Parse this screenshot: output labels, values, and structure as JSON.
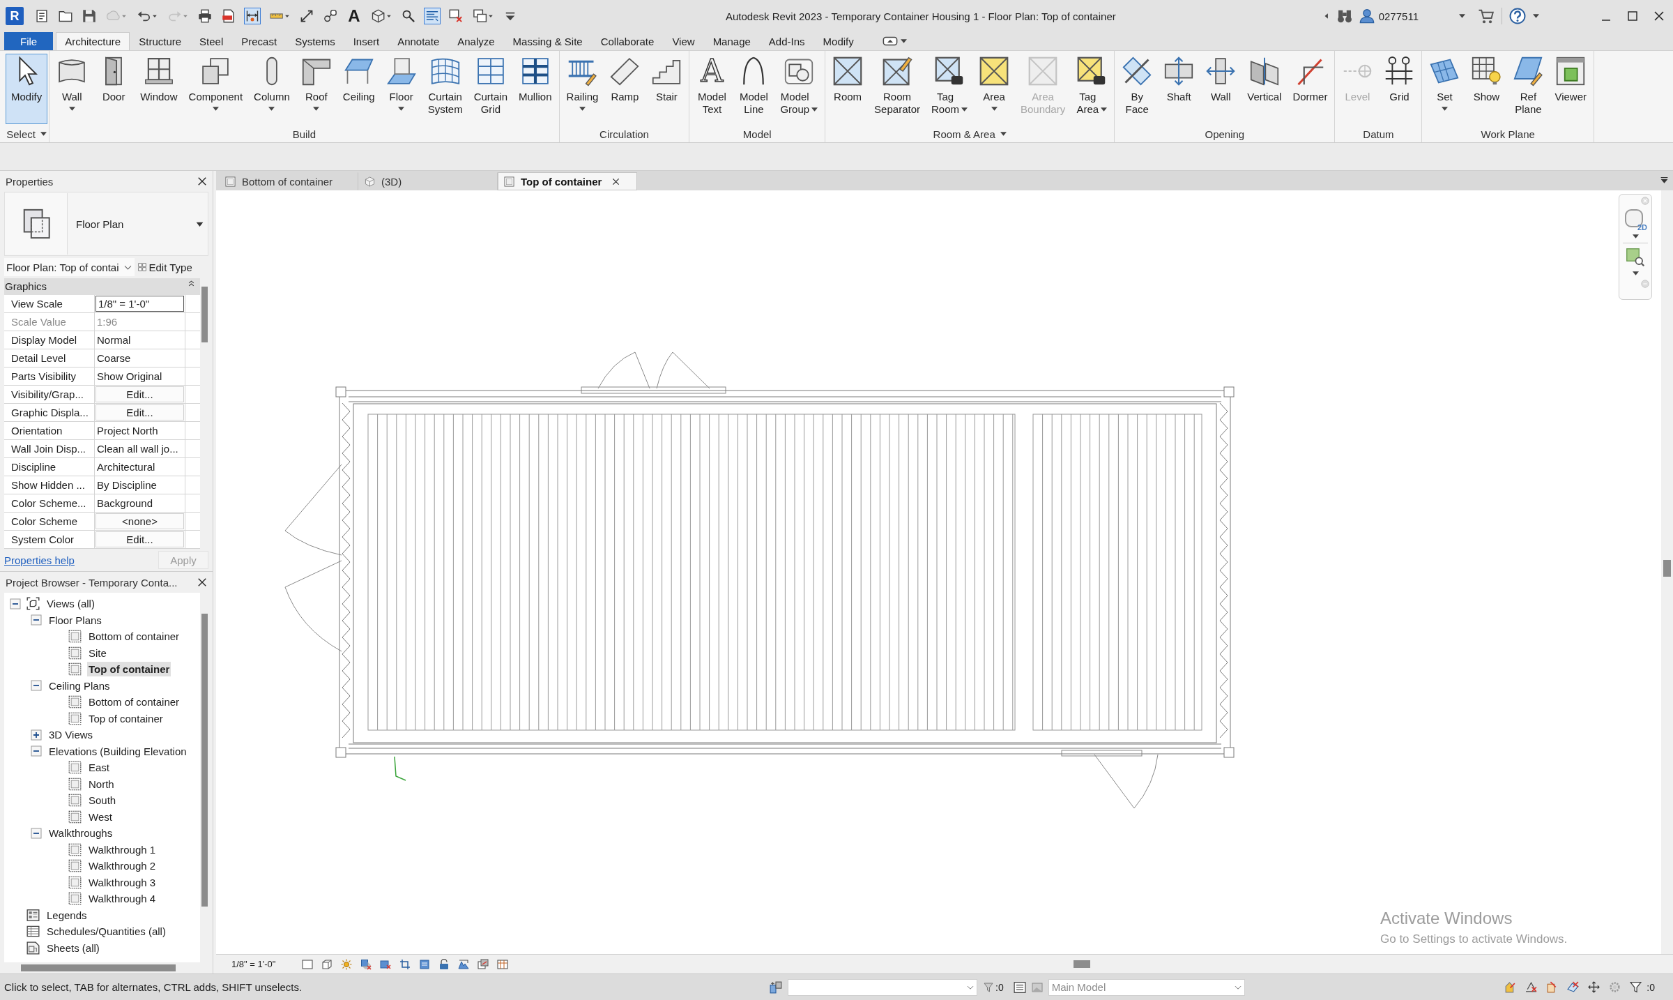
{
  "title_bar": {
    "logo": "R",
    "quick_access": [
      {
        "on": false,
        "dropdown": false,
        "disabled": false
      },
      {
        "on": false,
        "dropdown": false,
        "disabled": false
      },
      {
        "on": false,
        "dropdown": false,
        "disabled": false
      },
      {
        "on": false,
        "dropdown": true,
        "disabled": true
      },
      {
        "on": false,
        "dropdown": true,
        "disabled": false
      },
      {
        "on": false,
        "dropdown": true,
        "disabled": true
      },
      {
        "on": false,
        "dropdown": false,
        "disabled": false
      },
      {
        "on": false,
        "dropdown": false,
        "disabled": false
      },
      {
        "on": true,
        "dropdown": false,
        "disabled": false
      },
      {
        "on": false,
        "dropdown": true,
        "disabled": false
      },
      {
        "on": false,
        "dropdown": false,
        "disabled": false
      },
      {
        "on": false,
        "dropdown": false,
        "disabled": false
      },
      {
        "on": false,
        "dropdown": false,
        "disabled": false,
        "glyph": "A"
      },
      {
        "on": false,
        "dropdown": true,
        "disabled": false
      },
      {
        "on": false,
        "dropdown": false,
        "disabled": false
      },
      {
        "on": true,
        "dropdown": false,
        "disabled": false
      },
      {
        "on": false,
        "dropdown": false,
        "disabled": false
      },
      {
        "on": false,
        "dropdown": true,
        "disabled": false
      },
      {
        "on": false,
        "dropdown": false,
        "disabled": false
      }
    ],
    "title": "Autodesk Revit 2023 - Temporary Container Housing 1 - Floor Plan: Top of container",
    "user": "0277511"
  },
  "ribbon": {
    "file": "File",
    "tabs": [
      {
        "label": "Architecture",
        "selected": true
      },
      {
        "label": "Structure",
        "selected": false
      },
      {
        "label": "Steel",
        "selected": false
      },
      {
        "label": "Precast",
        "selected": false
      },
      {
        "label": "Systems",
        "selected": false
      },
      {
        "label": "Insert",
        "selected": false
      },
      {
        "label": "Annotate",
        "selected": false
      },
      {
        "label": "Analyze",
        "selected": false
      },
      {
        "label": "Massing & Site",
        "selected": false
      },
      {
        "label": "Collaborate",
        "selected": false
      },
      {
        "label": "View",
        "selected": false
      },
      {
        "label": "Manage",
        "selected": false
      },
      {
        "label": "Add-Ins",
        "selected": false
      },
      {
        "label": "Modify",
        "selected": false
      }
    ],
    "panels": [
      {
        "label": "Select",
        "dropdown": true,
        "tools": [
          {
            "label": "Modify",
            "dropdown": false,
            "disabled": false,
            "selected": true
          }
        ]
      },
      {
        "label": "Build",
        "dropdown": false,
        "tools": [
          {
            "label": "Wall",
            "dropdown": true,
            "disabled": false,
            "selected": false
          },
          {
            "label": "Door",
            "dropdown": false,
            "disabled": false,
            "selected": false
          },
          {
            "label": "Window",
            "dropdown": false,
            "disabled": false,
            "selected": false
          },
          {
            "label": "Component",
            "dropdown": true,
            "disabled": false,
            "selected": false
          },
          {
            "label": "Column",
            "dropdown": true,
            "disabled": false,
            "selected": false
          },
          {
            "label": "Roof",
            "dropdown": true,
            "disabled": false,
            "selected": false
          },
          {
            "label": "Ceiling",
            "dropdown": false,
            "disabled": false,
            "selected": false
          },
          {
            "label": "Floor",
            "dropdown": true,
            "disabled": false,
            "selected": false
          },
          {
            "label": "Curtain System",
            "dropdown": false,
            "disabled": false,
            "selected": false
          },
          {
            "label": "Curtain Grid",
            "dropdown": false,
            "disabled": false,
            "selected": false
          },
          {
            "label": "Mullion",
            "dropdown": false,
            "disabled": false,
            "selected": false
          }
        ]
      },
      {
        "label": "Circulation",
        "dropdown": false,
        "tools": [
          {
            "label": "Railing",
            "dropdown": true,
            "disabled": false,
            "selected": false
          },
          {
            "label": "Ramp",
            "dropdown": false,
            "disabled": false,
            "selected": false
          },
          {
            "label": "Stair",
            "dropdown": false,
            "disabled": false,
            "selected": false
          }
        ]
      },
      {
        "label": "Model",
        "dropdown": false,
        "tools": [
          {
            "label": "Model Text",
            "dropdown": false,
            "disabled": false,
            "selected": false,
            "glyph": "A"
          },
          {
            "label": "Model Line",
            "dropdown": false,
            "disabled": false,
            "selected": false
          },
          {
            "label": "Model Group",
            "dropdown": true,
            "disabled": false,
            "selected": false
          }
        ]
      },
      {
        "label": "Room & Area",
        "dropdown": true,
        "tools": [
          {
            "label": "Room",
            "dropdown": false,
            "disabled": false,
            "selected": false
          },
          {
            "label": "Room Separator",
            "dropdown": false,
            "disabled": false,
            "selected": false
          },
          {
            "label": "Tag Room",
            "dropdown": true,
            "disabled": false,
            "selected": false
          },
          {
            "label": "Area",
            "dropdown": true,
            "disabled": false,
            "selected": false
          },
          {
            "label": "Area Boundary",
            "dropdown": false,
            "disabled": true,
            "selected": false
          },
          {
            "label": "Tag Area",
            "dropdown": true,
            "disabled": false,
            "selected": false
          }
        ]
      },
      {
        "label": "Opening",
        "dropdown": false,
        "tools": [
          {
            "label": "By Face",
            "dropdown": false,
            "disabled": false,
            "selected": false
          },
          {
            "label": "Shaft",
            "dropdown": false,
            "disabled": false,
            "selected": false
          },
          {
            "label": "Wall",
            "dropdown": false,
            "disabled": false,
            "selected": false
          },
          {
            "label": "Vertical",
            "dropdown": false,
            "disabled": false,
            "selected": false
          },
          {
            "label": "Dormer",
            "dropdown": false,
            "disabled": false,
            "selected": false
          }
        ]
      },
      {
        "label": "Datum",
        "dropdown": false,
        "tools": [
          {
            "label": "Level",
            "dropdown": false,
            "disabled": true,
            "selected": false
          },
          {
            "label": "Grid",
            "dropdown": false,
            "disabled": false,
            "selected": false
          }
        ]
      },
      {
        "label": "Work Plane",
        "dropdown": false,
        "tools": [
          {
            "label": "Set",
            "dropdown": true,
            "disabled": false,
            "selected": false
          },
          {
            "label": "Show",
            "dropdown": false,
            "disabled": false,
            "selected": false
          },
          {
            "label": "Ref Plane",
            "dropdown": false,
            "disabled": false,
            "selected": false
          },
          {
            "label": "Viewer",
            "dropdown": false,
            "disabled": false,
            "selected": false
          }
        ]
      }
    ]
  },
  "properties": {
    "title": "Properties",
    "type_name": "Floor Plan",
    "instance": "Floor Plan: Top of contai",
    "edit_type": "Edit Type",
    "group": "Graphics",
    "rows": [
      {
        "label": "View Scale",
        "value": "1/8\" = 1'-0\"",
        "kind": "input"
      },
      {
        "label": "Scale Value",
        "value": "1:96",
        "kind": "readonly"
      },
      {
        "label": "Display Model",
        "value": "Normal",
        "kind": "text"
      },
      {
        "label": "Detail Level",
        "value": "Coarse",
        "kind": "text"
      },
      {
        "label": "Parts Visibility",
        "value": "Show Original",
        "kind": "text"
      },
      {
        "label": "Visibility/Grap...",
        "value": "Edit...",
        "kind": "button"
      },
      {
        "label": "Graphic Displa...",
        "value": "Edit...",
        "kind": "button"
      },
      {
        "label": "Orientation",
        "value": "Project North",
        "kind": "text"
      },
      {
        "label": "Wall Join Disp...",
        "value": "Clean all wall jo...",
        "kind": "text"
      },
      {
        "label": "Discipline",
        "value": "Architectural",
        "kind": "text"
      },
      {
        "label": "Show Hidden ...",
        "value": "By Discipline",
        "kind": "text"
      },
      {
        "label": "Color Scheme...",
        "value": "Background",
        "kind": "text"
      },
      {
        "label": "Color Scheme",
        "value": "<none>",
        "kind": "button"
      },
      {
        "label": "System Color",
        "value": "Edit...",
        "kind": "button"
      }
    ],
    "help_link": "Properties help",
    "apply": {
      "label": "Apply",
      "disabled": true
    }
  },
  "project_browser": {
    "title": "Project Browser - Temporary Conta...",
    "tree": [
      {
        "label": "Views (all)",
        "expanded": true,
        "selected": false,
        "children": [
          {
            "label": "Floor Plans",
            "expanded": true,
            "selected": false,
            "children": [
              {
                "label": "Bottom of container",
                "selected": false
              },
              {
                "label": "Site",
                "selected": false
              },
              {
                "label": "Top of container",
                "selected": true
              }
            ]
          },
          {
            "label": "Ceiling Plans",
            "expanded": true,
            "selected": false,
            "children": [
              {
                "label": "Bottom of container",
                "selected": false
              },
              {
                "label": "Top of container",
                "selected": false
              }
            ]
          },
          {
            "label": "3D Views",
            "expanded": false,
            "selected": false
          },
          {
            "label": "Elevations (Building Elevation",
            "expanded": true,
            "selected": false,
            "children": [
              {
                "label": "East",
                "selected": false
              },
              {
                "label": "North",
                "selected": false
              },
              {
                "label": "South",
                "selected": false
              },
              {
                "label": "West",
                "selected": false
              }
            ]
          },
          {
            "label": "Walkthroughs",
            "expanded": true,
            "selected": false,
            "children": [
              {
                "label": "Walkthrough 1",
                "selected": false
              },
              {
                "label": "Walkthrough 2",
                "selected": false
              },
              {
                "label": "Walkthrough 3",
                "selected": false
              },
              {
                "label": "Walkthrough 4",
                "selected": false
              }
            ]
          }
        ]
      },
      {
        "label": "Legends",
        "selected": false
      },
      {
        "label": "Schedules/Quantities (all)",
        "selected": false
      },
      {
        "label": "Sheets (all)",
        "selected": false
      }
    ]
  },
  "view": {
    "tabs": [
      {
        "label": "Bottom of container",
        "selected": false
      },
      {
        "label": "(3D)",
        "selected": false
      },
      {
        "label": "Top of container",
        "selected": true
      }
    ],
    "nav_wheel_label": "2D",
    "scale": "1/8\" = 1'-0\""
  },
  "status_bar": {
    "message": "Click to select, TAB for alternates, CTRL adds, SHIFT unselects.",
    "selection_count": ":0",
    "model_field": {
      "value": "Main Model",
      "disabled": true
    },
    "filter_count": ":0"
  },
  "os_notice": {
    "title": "Activate Windows",
    "subtitle": "Go to Settings to activate Windows."
  }
}
